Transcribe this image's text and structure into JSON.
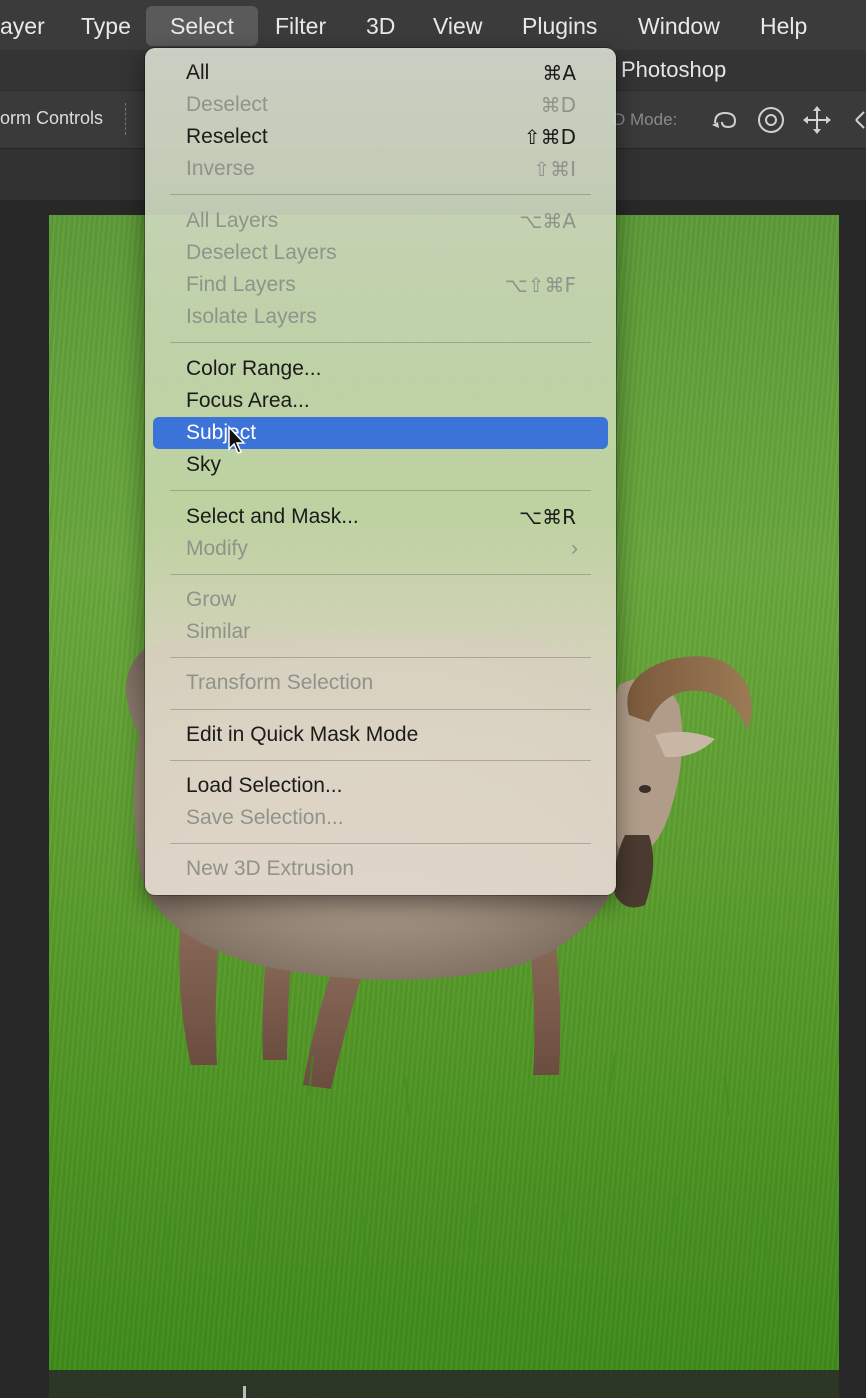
{
  "menubar": {
    "items": [
      {
        "label": "ayer"
      },
      {
        "label": "Type"
      },
      {
        "label": "Select"
      },
      {
        "label": "Filter"
      },
      {
        "label": "3D"
      },
      {
        "label": "View"
      },
      {
        "label": "Plugins"
      },
      {
        "label": "Window"
      },
      {
        "label": "Help"
      }
    ],
    "active": "Select"
  },
  "titlebar": {
    "title": "Photoshop"
  },
  "optionsbar": {
    "transform_label": "orm Controls",
    "mode_label": "D Mode:",
    "icons": [
      "orbit-3d-icon",
      "roll-3d-icon",
      "pan-3d-icon",
      "slide-3d-icon"
    ]
  },
  "select_menu": {
    "items": [
      {
        "label": "All",
        "shortcut": "⌘A",
        "enabled": true
      },
      {
        "label": "Deselect",
        "shortcut": "⌘D",
        "enabled": false
      },
      {
        "label": "Reselect",
        "shortcut": "⇧⌘D",
        "enabled": true
      },
      {
        "label": "Inverse",
        "shortcut": "⇧⌘I",
        "enabled": false
      },
      {
        "label": "All Layers",
        "shortcut": "⌥⌘A",
        "enabled": false
      },
      {
        "label": "Deselect Layers",
        "shortcut": "",
        "enabled": false
      },
      {
        "label": "Find Layers",
        "shortcut": "⌥⇧⌘F",
        "enabled": false
      },
      {
        "label": "Isolate Layers",
        "shortcut": "",
        "enabled": false
      },
      {
        "label": "Color Range...",
        "shortcut": "",
        "enabled": true
      },
      {
        "label": "Focus Area...",
        "shortcut": "",
        "enabled": true
      },
      {
        "label": "Subject",
        "shortcut": "",
        "enabled": true,
        "highlighted": true
      },
      {
        "label": "Sky",
        "shortcut": "",
        "enabled": true
      },
      {
        "label": "Select and Mask...",
        "shortcut": "⌥⌘R",
        "enabled": true
      },
      {
        "label": "Modify",
        "shortcut": "",
        "enabled": false,
        "submenu": "›"
      },
      {
        "label": "Grow",
        "shortcut": "",
        "enabled": false
      },
      {
        "label": "Similar",
        "shortcut": "",
        "enabled": false
      },
      {
        "label": "Transform Selection",
        "shortcut": "",
        "enabled": false
      },
      {
        "label": "Edit in Quick Mask Mode",
        "shortcut": "",
        "enabled": true
      },
      {
        "label": "Load Selection...",
        "shortcut": "",
        "enabled": true
      },
      {
        "label": "Save Selection...",
        "shortcut": "",
        "enabled": false
      },
      {
        "label": "New 3D Extrusion",
        "shortcut": "",
        "enabled": false
      }
    ],
    "highlight_color": "#3b73d9"
  },
  "colors": {
    "menubar_bg": "#3b3b3b",
    "canvas_grass": "#5c9e2f",
    "highlight": "#3b73d9"
  }
}
